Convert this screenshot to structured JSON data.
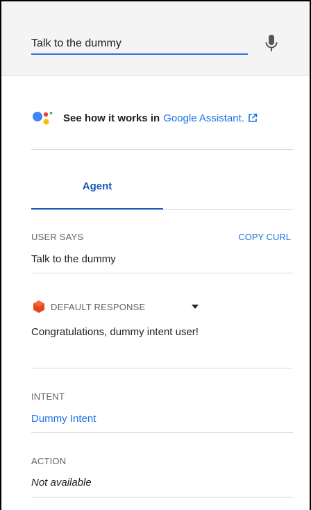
{
  "query": {
    "value": "Talk to the dummy",
    "placeholder": ""
  },
  "assistant_banner": {
    "text": "See how it works in",
    "link": "Google Assistant."
  },
  "tabs": [
    {
      "label": "Agent"
    }
  ],
  "user_says": {
    "label": "USER SAYS",
    "copy_curl": "COPY CURL",
    "value": "Talk to the dummy"
  },
  "response": {
    "label": "DEFAULT RESPONSE",
    "text": "Congratulations, dummy intent user!"
  },
  "intent": {
    "label": "INTENT",
    "value": "Dummy Intent"
  },
  "action": {
    "label": "ACTION",
    "value": "Not available"
  },
  "colors": {
    "accent": "#1a73e8",
    "tab": "#1a57b8",
    "hex_icon": "#e8451f"
  }
}
